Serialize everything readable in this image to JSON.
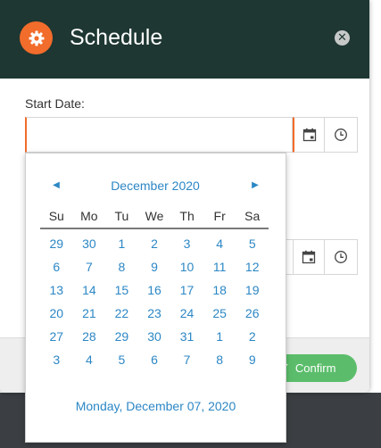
{
  "dialog": {
    "title": "Schedule",
    "icon": "gear-icon",
    "close_icon": "close-icon",
    "colors": {
      "header_bg": "#1e3732",
      "accent": "#f26c2b",
      "link": "#2c87c5",
      "confirm": "#5bbd6b"
    }
  },
  "start_date": {
    "label": "Start Date:",
    "value": "",
    "calendar_icon": "calendar-icon",
    "clock_icon": "clock-icon"
  },
  "end_date": {
    "value": "",
    "calendar_icon": "calendar-icon",
    "clock_icon": "clock-icon"
  },
  "footer": {
    "confirm_label": "Confirm",
    "confirm_icon": "check-icon"
  },
  "calendar": {
    "month_title": "December 2020",
    "prev_glyph": "◀",
    "next_glyph": "▶",
    "weekdays": [
      "Su",
      "Mo",
      "Tu",
      "We",
      "Th",
      "Fr",
      "Sa"
    ],
    "days": [
      "29",
      "30",
      "1",
      "2",
      "3",
      "4",
      "5",
      "6",
      "7",
      "8",
      "9",
      "10",
      "11",
      "12",
      "13",
      "14",
      "15",
      "16",
      "17",
      "18",
      "19",
      "20",
      "21",
      "22",
      "23",
      "24",
      "25",
      "26",
      "27",
      "28",
      "29",
      "30",
      "31",
      "1",
      "2",
      "3",
      "4",
      "5",
      "6",
      "7",
      "8",
      "9"
    ],
    "today_label": "Monday, December 07, 2020"
  }
}
